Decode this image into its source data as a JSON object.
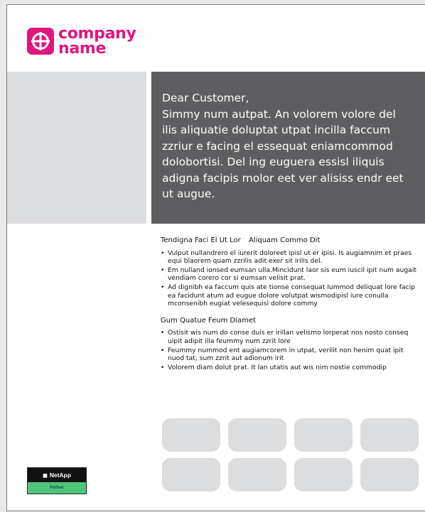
{
  "brand": {
    "name_line1": "company",
    "name_line2": "name",
    "color": "#e0167e",
    "icon": "crosshair-circle-icon"
  },
  "hero": {
    "greeting": "Dear Customer,",
    "body": "Simmy num autpat.  An volorem volore del ilis aliquatie doluptat utpat incilla faccum zzriur e facing el essequat eniamcommod dolobortisi.  Del ing euguera essisl iliquis adigna facipis molor eet ver alisiss endr eet ut augue.",
    "panel_color": "#5e5e61",
    "placeholder_color": "#dcdddf"
  },
  "sections": [
    {
      "title_a": "Tendigna Faci El Ut Lor",
      "title_b": "Aliquam Commo Dit",
      "bullets": [
        "Vulput nullandrero el iurerit doloreet ipisl ut er ipisi. Is augiamnim et praes equi blaorem quam zzrilis adit exer sit irilis del.",
        "Em nulland ionsed eumsan ulla.Mincidunt laor sis eum iuscil ipit num augait vendiam corero cor si eumsan velisit prat.",
        "Ad dignibh ea faccum quis ate tionse consequat lummod deliquat lore facip ea facidunt atum ad eugue dolore volutpat wismodipisl iure conulla mconsenibh eugiat velesequisl dolore commy"
      ]
    },
    {
      "title_a": "Gum Quatue Feum Diamet",
      "bullets": [
        "Ostisit wis num do conse duis er irillan velismo lorperat nos nosto conseq uipit adipit illa feummy num zzrit lore",
        "Feummy nummod ent augiamcorem in utpat, verilit non henim quat ipit nuod tat, sum zzrit aut adionum irit",
        "Volorem diam dolut prat. It lan utatis aut wis nim nostie commodip"
      ]
    }
  ],
  "tiles": {
    "count": 8,
    "color": "#dcdddf"
  },
  "partner_badge": {
    "brand": "NetApp",
    "label": "Partner",
    "icon": "netapp-logo-icon",
    "top_color": "#111111",
    "bottom_color": "#4cc77a"
  }
}
